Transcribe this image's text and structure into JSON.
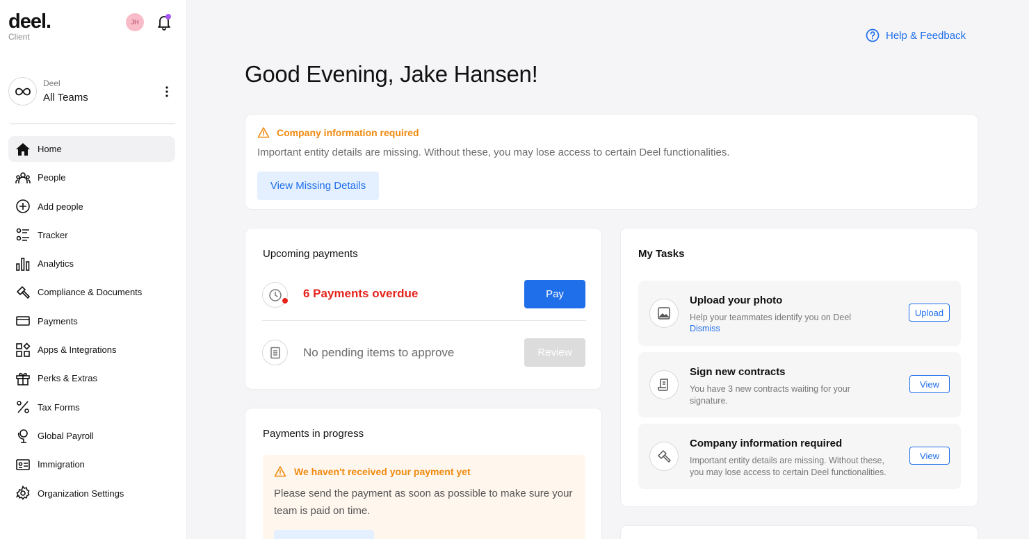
{
  "brand": {
    "logo": "deel.",
    "subtitle": "Client"
  },
  "user": {
    "initials": "JH"
  },
  "team": {
    "org": "Deel",
    "name": "All Teams"
  },
  "nav": [
    {
      "label": "Home",
      "icon": "home-icon",
      "active": true
    },
    {
      "label": "People",
      "icon": "people-icon"
    },
    {
      "label": "Add people",
      "icon": "add-circle-icon"
    },
    {
      "label": "Tracker",
      "icon": "tracker-icon"
    },
    {
      "label": "Analytics",
      "icon": "analytics-icon"
    },
    {
      "label": "Compliance & Documents",
      "icon": "gavel-icon"
    },
    {
      "label": "Payments",
      "icon": "card-icon"
    },
    {
      "label": "Apps & Integrations",
      "icon": "apps-icon"
    },
    {
      "label": "Perks & Extras",
      "icon": "gift-icon"
    },
    {
      "label": "Tax Forms",
      "icon": "percent-icon"
    },
    {
      "label": "Global Payroll",
      "icon": "globe-payroll-icon"
    },
    {
      "label": "Immigration",
      "icon": "id-card-icon"
    },
    {
      "label": "Organization Settings",
      "icon": "gear-icon"
    }
  ],
  "header": {
    "help_label": "Help & Feedback",
    "greeting": "Good Evening, Jake Hansen!"
  },
  "alert": {
    "title": "Company information required",
    "description": "Important entity details are missing. Without these, you may lose access to certain Deel functionalities.",
    "button": "View Missing Details"
  },
  "upcoming_payments": {
    "title": "Upcoming payments",
    "overdue_text": "6 Payments overdue",
    "pay_button": "Pay",
    "pending_text": "No pending items to approve",
    "review_button": "Review"
  },
  "payments_in_progress": {
    "title": "Payments in progress",
    "warning_title": "We haven't received your payment yet",
    "warning_text": "Please send the payment as soon as possible to make sure your team is paid on time."
  },
  "tasks": {
    "title": "My Tasks",
    "items": [
      {
        "title": "Upload your photo",
        "description": "Help your teammates identify you on Deel",
        "link": "Dismiss",
        "button": "Upload"
      },
      {
        "title": "Sign new contracts",
        "description": "You have 3 new contracts waiting for your signature.",
        "button": "View"
      },
      {
        "title": "Company information required",
        "description": "Important entity details are missing. Without these, you may lose access to certain Deel functionalities.",
        "button": "View"
      }
    ]
  },
  "colors": {
    "accent": "#1f6feb",
    "warning": "#ef8a0e",
    "danger": "#e5231b",
    "notification": "#a855f7"
  }
}
